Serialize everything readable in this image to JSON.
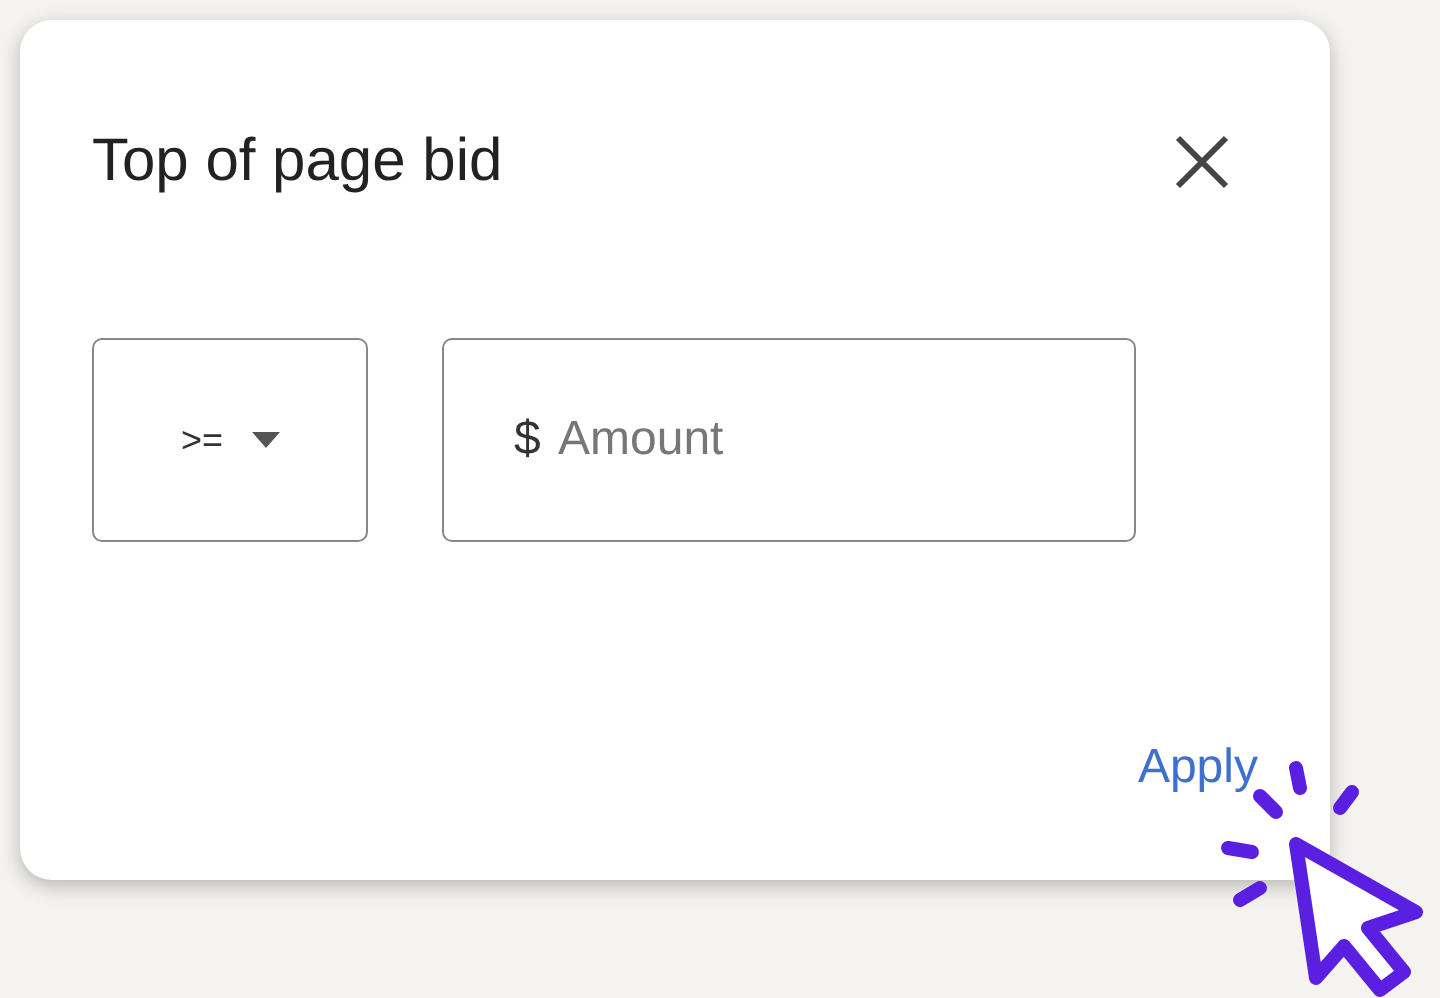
{
  "dialog": {
    "title": "Top of page bid",
    "operator_dropdown": {
      "value": ">="
    },
    "amount_field": {
      "prefix": "$",
      "placeholder": "Amount"
    },
    "apply_link": "Apply"
  }
}
